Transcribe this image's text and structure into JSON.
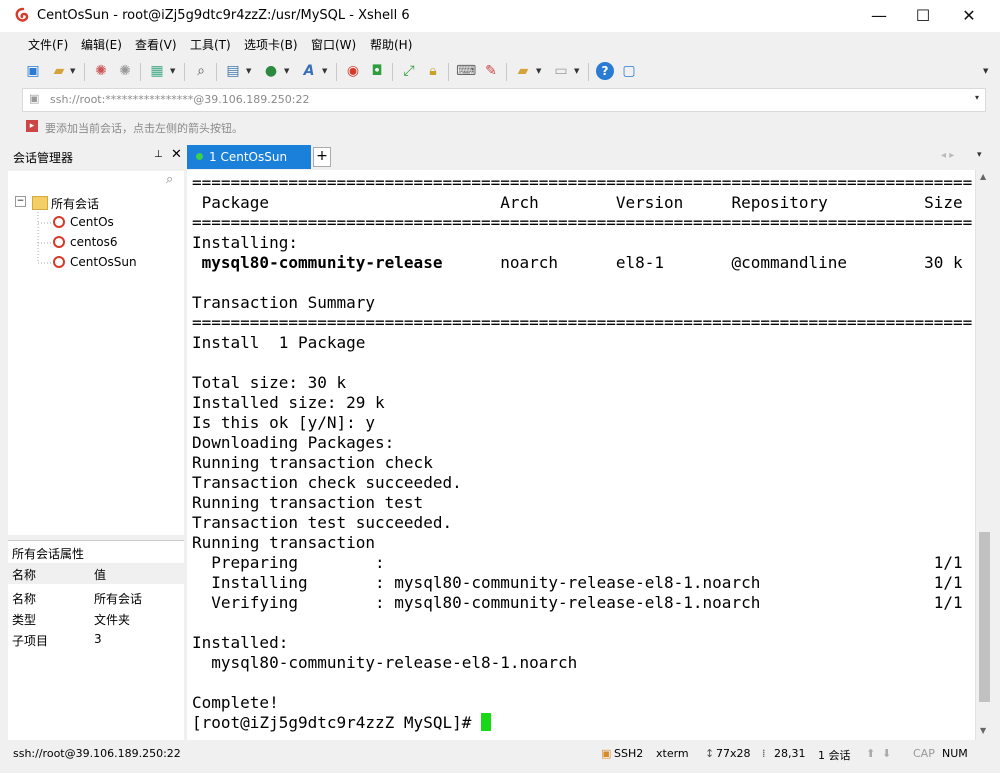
{
  "window": {
    "title": "CentOsSun - root@iZj5g9dtc9r4zzZ:/usr/MySQL - Xshell 6",
    "minimize": "—",
    "maximize": "☐",
    "close": "✕"
  },
  "menu": [
    "文件(F)",
    "编辑(E)",
    "查看(V)",
    "工具(T)",
    "选项卡(B)",
    "窗口(W)",
    "帮助(H)"
  ],
  "address": {
    "value": "ssh://root:****************@39.106.189.250:22",
    "dropdown": "▾"
  },
  "hint": {
    "text": "要添加当前会话，点击左侧的箭头按钮。"
  },
  "session_manager": {
    "title": "会话管理器",
    "pin": "⊥",
    "close": "✕",
    "search_placeholder": "",
    "tree": {
      "root_label": "所有会话",
      "expander": "−",
      "items": [
        "CentOs",
        "centos6",
        "CentOsSun"
      ]
    },
    "properties": {
      "title": "所有会话属性",
      "header": {
        "name": "名称",
        "value": "值"
      },
      "rows": [
        {
          "name": "名称",
          "value": "所有会话"
        },
        {
          "name": "类型",
          "value": "文件夹"
        },
        {
          "name": "子项目",
          "value": "3"
        }
      ]
    }
  },
  "tabs": {
    "active": "1 CentOsSun",
    "plus": "+",
    "nav": "◂ ▸",
    "menu": "▾"
  },
  "terminal": {
    "lines": [
      {
        "text": "=================================================================================",
        "bold": false
      },
      {
        "text": " Package                        Arch        Version     Repository          Size",
        "bold": false
      },
      {
        "text": "=================================================================================",
        "bold": false
      },
      {
        "text": "Installing:",
        "bold": false
      },
      {
        "text": " mysql80-community-release",
        "bold": true,
        "rest": "      noarch      el8-1       @commandline        30 k"
      },
      {
        "text": "",
        "bold": false
      },
      {
        "text": "Transaction Summary",
        "bold": false
      },
      {
        "text": "=================================================================================",
        "bold": false
      },
      {
        "text": "Install  1 Package",
        "bold": false
      },
      {
        "text": "",
        "bold": false
      },
      {
        "text": "Total size: 30 k",
        "bold": false
      },
      {
        "text": "Installed size: 29 k",
        "bold": false
      },
      {
        "text": "Is this ok [y/N]: y",
        "bold": false
      },
      {
        "text": "Downloading Packages:",
        "bold": false
      },
      {
        "text": "Running transaction check",
        "bold": false
      },
      {
        "text": "Transaction check succeeded.",
        "bold": false
      },
      {
        "text": "Running transaction test",
        "bold": false
      },
      {
        "text": "Transaction test succeeded.",
        "bold": false
      },
      {
        "text": "Running transaction",
        "bold": false
      },
      {
        "text": "  Preparing        :                                                         1/1",
        "bold": false
      },
      {
        "text": "  Installing       : mysql80-community-release-el8-1.noarch                  1/1",
        "bold": false
      },
      {
        "text": "  Verifying        : mysql80-community-release-el8-1.noarch                  1/1",
        "bold": false
      },
      {
        "text": "",
        "bold": false
      },
      {
        "text": "Installed:",
        "bold": false
      },
      {
        "text": "  mysql80-community-release-el8-1.noarch",
        "bold": false
      },
      {
        "text": "",
        "bold": false
      },
      {
        "text": "Complete!",
        "bold": false
      },
      {
        "text": "[root@iZj5g9dtc9r4zzZ MySQL]# ",
        "bold": false
      }
    ],
    "cursor_color": "#18d818"
  },
  "status": {
    "connection": "ssh://root@39.106.189.250:22",
    "protocol": "SSH2",
    "terminal_type": "xterm",
    "size": "77x28",
    "position": "28,31",
    "sessions": "1 会话",
    "caps": "CAP",
    "num": "NUM"
  },
  "colors": {
    "tab_active": "#1a80d9",
    "logo_red": "#d63b2a",
    "cursor_green": "#18d818"
  }
}
